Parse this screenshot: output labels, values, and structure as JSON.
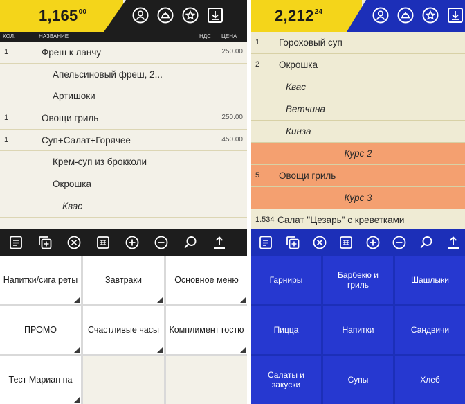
{
  "left": {
    "total_main": "1,165",
    "total_cents": "00",
    "columns": {
      "qty": "КОЛ.",
      "name": "НАЗВАНИЕ",
      "vat": "НДС",
      "price": "ЦЕНА"
    },
    "items": [
      {
        "qty": "1",
        "name": "Фреш к ланчу",
        "price": "250.00",
        "type": "item"
      },
      {
        "qty": "",
        "name": "Апельсиновый фреш, 2...",
        "price": "",
        "type": "sub"
      },
      {
        "qty": "",
        "name": "Артишоки",
        "price": "",
        "type": "sub"
      },
      {
        "qty": "1",
        "name": "Овощи гриль",
        "price": "250.00",
        "type": "item"
      },
      {
        "qty": "1",
        "name": "Суп+Салат+Горячее",
        "price": "450.00",
        "type": "item"
      },
      {
        "qty": "",
        "name": "Крем-суп из брокколи",
        "price": "",
        "type": "sub"
      },
      {
        "qty": "",
        "name": "Окрошка",
        "price": "",
        "type": "sub"
      },
      {
        "qty": "",
        "name": "Квас",
        "price": "",
        "type": "mod"
      }
    ],
    "categories": [
      "Напитки/сига реты",
      "Завтраки",
      "Основное меню",
      "ПРОМО",
      "Счастливые часы",
      "Комплимент гостю",
      "Тест Мариан на",
      "",
      ""
    ]
  },
  "right": {
    "total_main": "2,212",
    "total_cents": "24",
    "items": [
      {
        "qty": "1",
        "name": "Гороховый суп",
        "type": "item"
      },
      {
        "qty": "2",
        "name": "Окрошка",
        "type": "item"
      },
      {
        "qty": "",
        "name": "Квас",
        "type": "mod"
      },
      {
        "qty": "",
        "name": "Ветчина",
        "type": "mod"
      },
      {
        "qty": "",
        "name": "Кинза",
        "type": "mod"
      },
      {
        "qty": "",
        "name": "Курс 2",
        "type": "course"
      },
      {
        "qty": "5",
        "name": "Овощи гриль",
        "type": "highlight"
      },
      {
        "qty": "",
        "name": "Курс 3",
        "type": "course"
      },
      {
        "qty": "1.534",
        "name": "Салат \"Цезарь\" с креветками",
        "type": "item"
      }
    ],
    "categories": [
      "Гарниры",
      "Барбекю и гриль",
      "Шашлыки",
      "Пицца",
      "Напитки",
      "Сандвичи",
      "Салаты и закуски",
      "Супы",
      "Хлеб"
    ]
  },
  "header_icons": [
    "user-circle-icon",
    "cloche-icon",
    "star-badge-icon",
    "download-icon"
  ],
  "toolbar_icons": [
    "receipt-icon",
    "copy-icon",
    "cancel-icon",
    "calculator-icon",
    "add-icon",
    "remove-icon",
    "search-icon",
    "upload-icon"
  ],
  "colors": {
    "yellow": "#f4d51a",
    "left_bar": "#1d1d1d",
    "right_bar": "#1c2fb8",
    "course": "#f4a070"
  }
}
